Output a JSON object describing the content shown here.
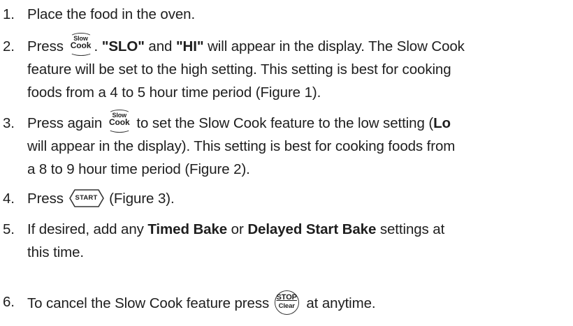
{
  "steps": [
    {
      "number": "1.",
      "text": "Place the food in the oven."
    },
    {
      "number": "2.",
      "before_key": "Press",
      "key": {
        "top": "Slow",
        "bottom": "Cook"
      },
      "after_key": ".",
      "code1": "\"SLO\"",
      "and": " and ",
      "code2": "\"HI\"",
      "rest_line1": " will appear in the display. The Slow Cook",
      "line2": "feature will be set to the high setting. This setting is best for cooking",
      "line3": "foods from a 4 to 5 hour time period (Figure 1)."
    },
    {
      "number": "3.",
      "before_key": "Press again",
      "key": {
        "top": "Slow",
        "bottom": "Cook"
      },
      "after_key_line1": "to set the Slow Cook feature to the low setting (",
      "bold_lo": "Lo",
      "line2": "will appear in the display). This setting is best for cooking foods from",
      "line3": "a 8 to 9 hour time period (Figure 2)."
    },
    {
      "number": "4.",
      "before_key": "Press",
      "key_label": "START",
      "after_key": "(Figure 3)."
    },
    {
      "number": "5.",
      "prefix": "If desired, add any ",
      "bold1": "Timed Bake",
      "mid": " or ",
      "bold2": "Delayed Start Bake",
      "suffix": " settings at",
      "line2": "this time."
    },
    {
      "number": "6.",
      "before_key": "To cancel the Slow Cook feature press",
      "key": {
        "top": "STOP",
        "bottom": "Clear"
      },
      "after_key": "at anytime."
    }
  ]
}
